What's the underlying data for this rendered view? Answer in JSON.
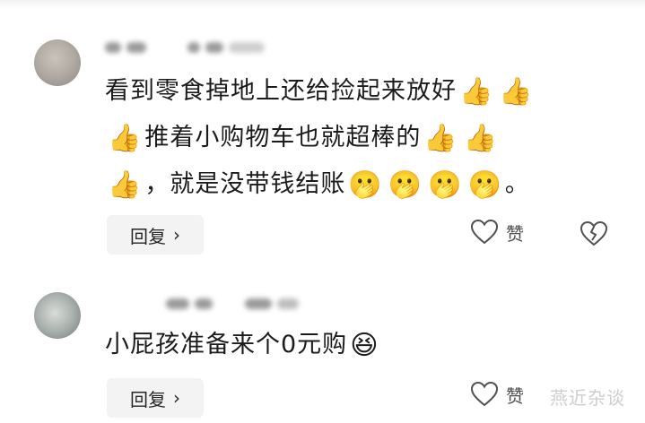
{
  "comments": [
    {
      "lines": [
        {
          "text": "看到零食掉地上还给捡起来放好",
          "emojis": [
            "👍",
            "👍"
          ]
        },
        {
          "pre_emojis": [
            "👍"
          ],
          "text": "推着小购物车也就超棒的",
          "emojis": [
            "👍",
            "👍"
          ]
        },
        {
          "pre_emojis": [
            "👍"
          ],
          "text": "，就是没带钱结账",
          "emojis": [
            "🫢",
            "🫢",
            "🫢",
            "🫢"
          ],
          "tail": "。"
        }
      ],
      "reply_label": "回复",
      "like_label": "赞"
    },
    {
      "lines": [
        {
          "text": "小屁孩准备来个0元购",
          "emojis": [
            "😆"
          ]
        }
      ],
      "reply_label": "回复",
      "like_label": "赞"
    }
  ],
  "icons": {
    "reply_chevron": "chevron-right-icon",
    "like": "heart-outline-icon",
    "dislike": "broken-heart-icon"
  },
  "watermark": "燕近杂谈",
  "colors": {
    "text": "#1b1b1b",
    "reply_bg": "#f3f3f3",
    "icon_gray": "#505050"
  }
}
